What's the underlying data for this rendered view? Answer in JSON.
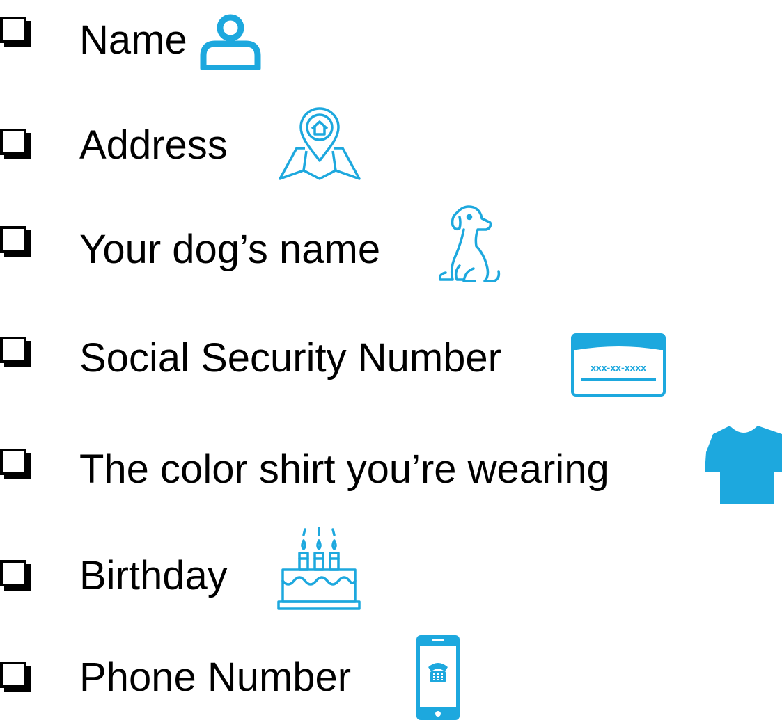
{
  "accent_color": "#1DA8DE",
  "items": [
    {
      "label": "Name",
      "icon": "person-icon"
    },
    {
      "label": "Address",
      "icon": "map-pin-home-icon"
    },
    {
      "label": "Your dog’s name",
      "icon": "dog-icon"
    },
    {
      "label": "Social Security Number",
      "icon": "ssn-card-icon",
      "icon_text": "xxx-xx-xxxx"
    },
    {
      "label": "The color shirt you’re wearing",
      "icon": "tshirt-icon"
    },
    {
      "label": "Birthday",
      "icon": "birthday-cake-icon"
    },
    {
      "label": "Phone Number",
      "icon": "smartphone-icon"
    }
  ]
}
